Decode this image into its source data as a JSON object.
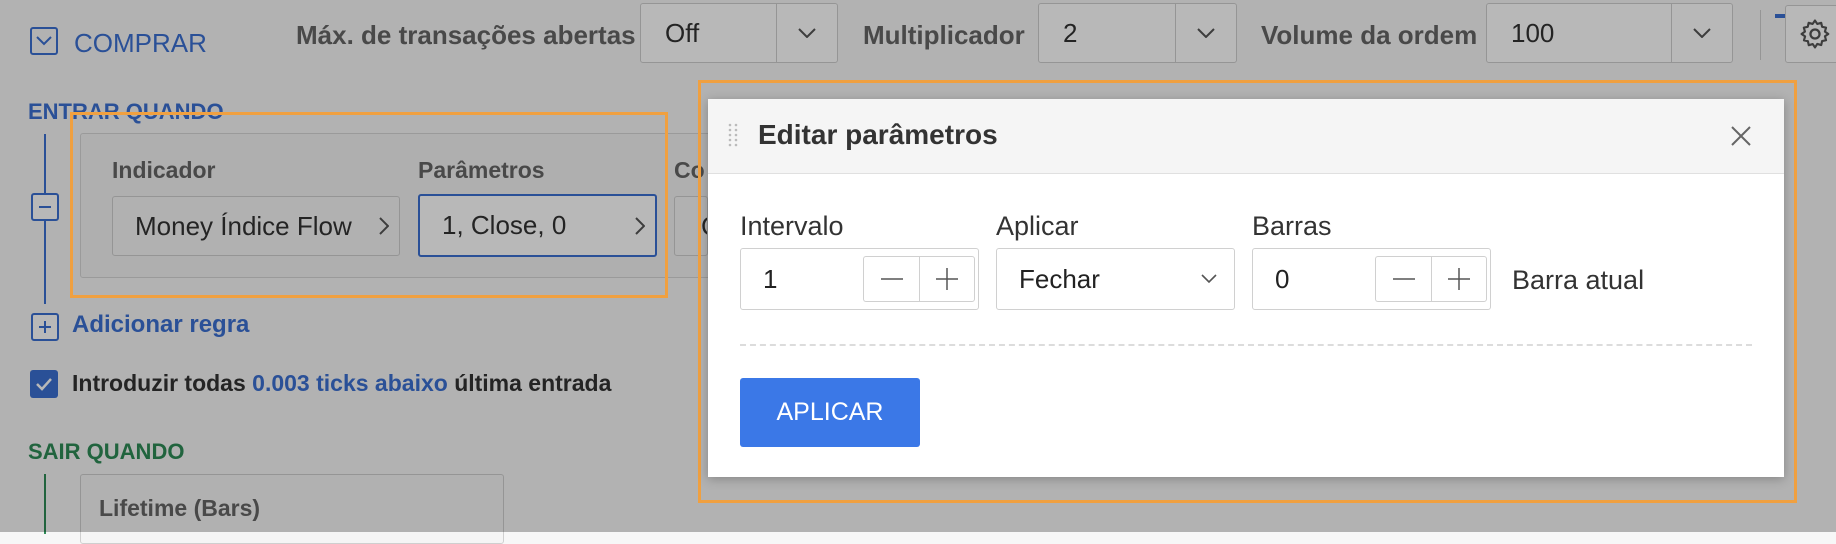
{
  "toolbar": {
    "buy_label": "COMPRAR",
    "max_trades_label": "Máx. de transações abertas",
    "max_trades_value": "Off",
    "multiplier_label": "Multiplicador",
    "multiplier_value": "2",
    "order_volume_label": "Volume da ordem",
    "order_volume_value": "100"
  },
  "entry": {
    "title": "ENTRAR QUANDO",
    "indicator_label": "Indicador",
    "indicator_value": "Money Índice Flow",
    "params_label": "Parâmetros",
    "params_value": "1, Close, 0",
    "cond_label": "Co",
    "cond_value": "C",
    "add_rule": "Adicionar regra"
  },
  "checkbox_line": {
    "prefix": "Introduzir todas",
    "link": "0.003 ticks abaixo",
    "suffix": "última entrada",
    "checked": true
  },
  "exit": {
    "title": "SAIR QUANDO",
    "item": "Lifetime (Bars)"
  },
  "modal": {
    "title": "Editar parâmetros",
    "interval_label": "Intervalo",
    "interval_value": "1",
    "apply_on_label": "Aplicar",
    "apply_on_value": "Fechar",
    "bars_label": "Barras",
    "bars_value": "0",
    "bars_note": "Barra atual",
    "apply_button": "APLICAR"
  },
  "colors": {
    "accent": "#3b6fd1",
    "highlight": "#f0a040",
    "exit_green": "#2e8b57",
    "apply_button": "#3b78e7"
  }
}
